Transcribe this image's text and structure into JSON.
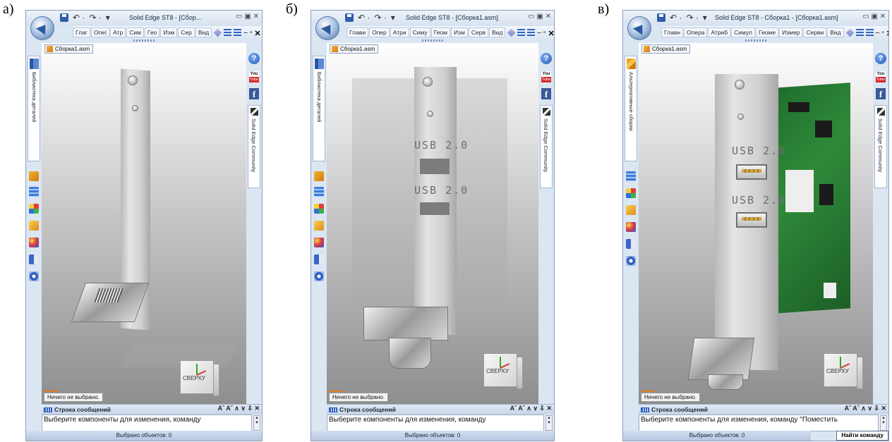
{
  "panels": [
    {
      "letter": "а)",
      "title": "Solid Edge ST8 - [Сбор...",
      "tabs": [
        "Глаг",
        "Опе|",
        "Атр",
        "Сим",
        "Гео",
        "Изм",
        "Сер",
        "Вид"
      ],
      "doc_tab": "Сборка1.asm",
      "left_vtab": "Библиотека деталей",
      "community": "Solid Edge Community",
      "status_none": "Ничего не выбрано.",
      "msg_title": "Строка сообщений",
      "msg_text": "Выберите компоненты для изменения, команду",
      "selected": "Выбрано объектов: 0",
      "viewcube": "СВЕРХУ",
      "usb_labels": []
    },
    {
      "letter": "б)",
      "title": "Solid Edge ST8 - [Сборка1.asm]",
      "tabs": [
        "Глави",
        "Опер",
        "Атри",
        "Симу",
        "Геом",
        "Изм",
        "Серв",
        "Вид"
      ],
      "doc_tab": "Сборка1.asm",
      "left_vtab": "Библиотека деталей",
      "community": "Solid Edge Community",
      "status_none": "Ничего не выбрано.",
      "msg_title": "Строка сообщений",
      "msg_text": "Выберите компоненты для изменения, команду",
      "selected": "Выбрано объектов: 0",
      "viewcube": "СВЕРХУ",
      "usb_labels": [
        "USB 2.0",
        "USB 2.0"
      ]
    },
    {
      "letter": "в)",
      "title": "Solid Edge ST8 - Сборка1 - [Сборка1.asm]",
      "tabs": [
        "Главн",
        "Опера",
        "Атриб",
        "Симул",
        "Геоме",
        "Измер",
        "Серви",
        "Вид"
      ],
      "doc_tab": "Сборка1.asm",
      "left_vtab": "Альтернативные сборки",
      "community": "Solid Edge Community",
      "status_none": "Ничего не выбрано.",
      "msg_title": "Строка сообщений",
      "msg_text": "Выберите компоненты для изменения, команду \"Поместить",
      "selected": "Выбрано объектов: 0",
      "viewcube": "СВЕРХУ",
      "usb_labels": [
        "USB 2.0",
        "USB 2.0"
      ],
      "find_command": "Найти команду"
    }
  ],
  "icons": {
    "help": "?",
    "youtube_top": "You",
    "youtube_bottom": "Tube",
    "facebook": "f",
    "msg_controls": "Aˆ Aˇ ∧ ∨ ⇩ ✕",
    "scroll_up": "▲",
    "scroll_down": "▼",
    "win_buttons": "▭ ▣ ✕",
    "undo": "↶ ·",
    "redo": "↷ ·",
    "dropdown": "▾"
  }
}
